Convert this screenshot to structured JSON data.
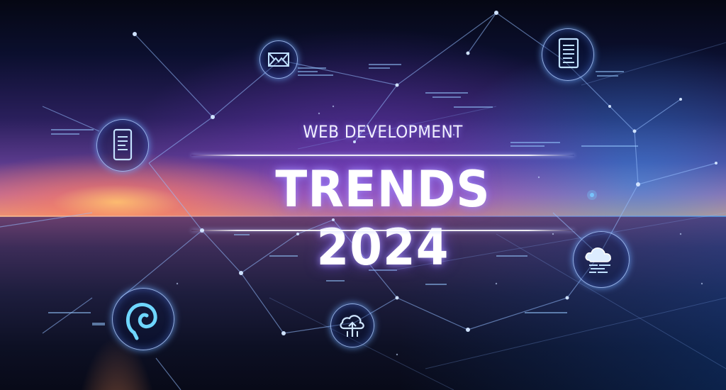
{
  "banner": {
    "subtitle": "WEB DEVELOPMENT",
    "headline": "TRENDS 2024"
  },
  "icons": [
    "image-gallery-icon",
    "mobile-document-icon",
    "document-page-icon",
    "cloud-data-icon",
    "cloud-upload-icon",
    "spiral-logo-icon"
  ],
  "colors": {
    "sunset": "#e89a7a",
    "violet": "#5a3a8c",
    "neon_blue": "#1e96f0",
    "text": "#ffffff"
  }
}
